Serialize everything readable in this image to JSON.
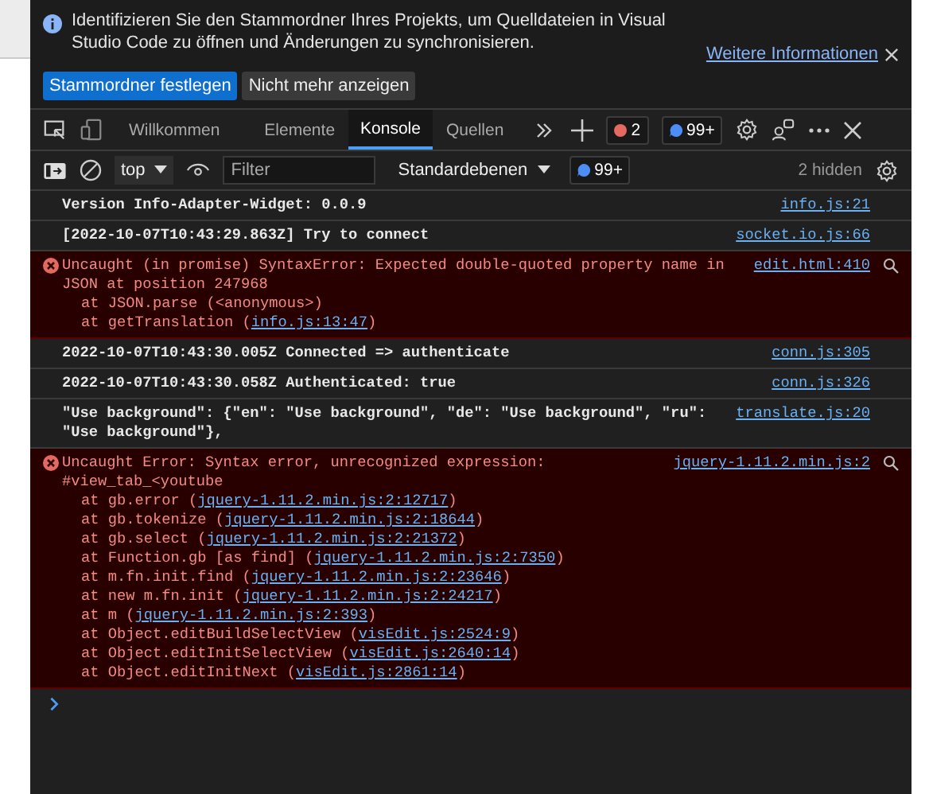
{
  "infobar": {
    "message": "Identifizieren Sie den Stammordner Ihres Projekts, um Quelldateien in Visual Studio Code zu öffnen und Änderungen zu synchronisieren.",
    "link": "Weitere Informationen",
    "buttons": [
      {
        "label": "Stammordner festlegen",
        "kind": "primary"
      },
      {
        "label": "Nicht mehr anzeigen",
        "kind": "secondary"
      }
    ]
  },
  "tabs": [
    {
      "label": "Willkommen",
      "selected": false
    },
    {
      "label": "Elemente",
      "selected": false
    },
    {
      "label": "Konsole",
      "selected": true
    },
    {
      "label": "Quellen",
      "selected": false
    }
  ],
  "counters": {
    "errors": "2",
    "messages": "99+"
  },
  "console_toolbar": {
    "context": "top",
    "filter_placeholder": "Filter",
    "levels": "Standardebenen",
    "messages": "99+",
    "hidden": "2 hidden"
  },
  "messages": [
    {
      "kind": "log",
      "text": "Version Info-Adapter-Widget: 0.0.9",
      "source": "info.js:21"
    },
    {
      "kind": "log",
      "text": "[2022-10-07T10:43:29.863Z] Try to connect",
      "source": "socket.io.js:66"
    },
    {
      "kind": "error",
      "text": "Uncaught (in promise) SyntaxError: Expected double-quoted property name in JSON at position 247968",
      "source": "edit.html:410",
      "frames": [
        {
          "prefix": "at JSON.parse (<anonymous>)"
        },
        {
          "prefix": "at getTranslation (",
          "link": "info.js:13:47",
          "suffix": ")"
        }
      ]
    },
    {
      "kind": "log",
      "text": "2022-10-07T10:43:30.005Z Connected => authenticate",
      "source": "conn.js:305"
    },
    {
      "kind": "log",
      "text": "2022-10-07T10:43:30.058Z Authenticated: true",
      "source": "conn.js:326"
    },
    {
      "kind": "log",
      "text": "\"Use background\": {\"en\": \"Use background\", \"de\": \"Use background\", \"ru\": \"Use background\"},",
      "source": "translate.js:20"
    },
    {
      "kind": "error",
      "text": "Uncaught Error: Syntax error, unrecognized expression: #view_tab_<youtube",
      "source": "jquery-1.11.2.min.js:2",
      "frames": [
        {
          "prefix": "at gb.error (",
          "link": "jquery-1.11.2.min.js:2:12717",
          "suffix": ")"
        },
        {
          "prefix": "at gb.tokenize (",
          "link": "jquery-1.11.2.min.js:2:18644",
          "suffix": ")"
        },
        {
          "prefix": "at gb.select (",
          "link": "jquery-1.11.2.min.js:2:21372",
          "suffix": ")"
        },
        {
          "prefix": "at Function.gb [as find] (",
          "link": "jquery-1.11.2.min.js:2:7350",
          "suffix": ")"
        },
        {
          "prefix": "at m.fn.init.find (",
          "link": "jquery-1.11.2.min.js:2:23646",
          "suffix": ")"
        },
        {
          "prefix": "at new m.fn.init (",
          "link": "jquery-1.11.2.min.js:2:24217",
          "suffix": ")"
        },
        {
          "prefix": "at m (",
          "link": "jquery-1.11.2.min.js:2:393",
          "suffix": ")"
        },
        {
          "prefix": "at Object.editBuildSelectView (",
          "link": "visEdit.js:2524:9",
          "suffix": ")"
        },
        {
          "prefix": "at Object.editInitSelectView (",
          "link": "visEdit.js:2640:14",
          "suffix": ")"
        },
        {
          "prefix": "at Object.editInitNext (",
          "link": "visEdit.js:2861:14",
          "suffix": ")"
        }
      ]
    }
  ]
}
